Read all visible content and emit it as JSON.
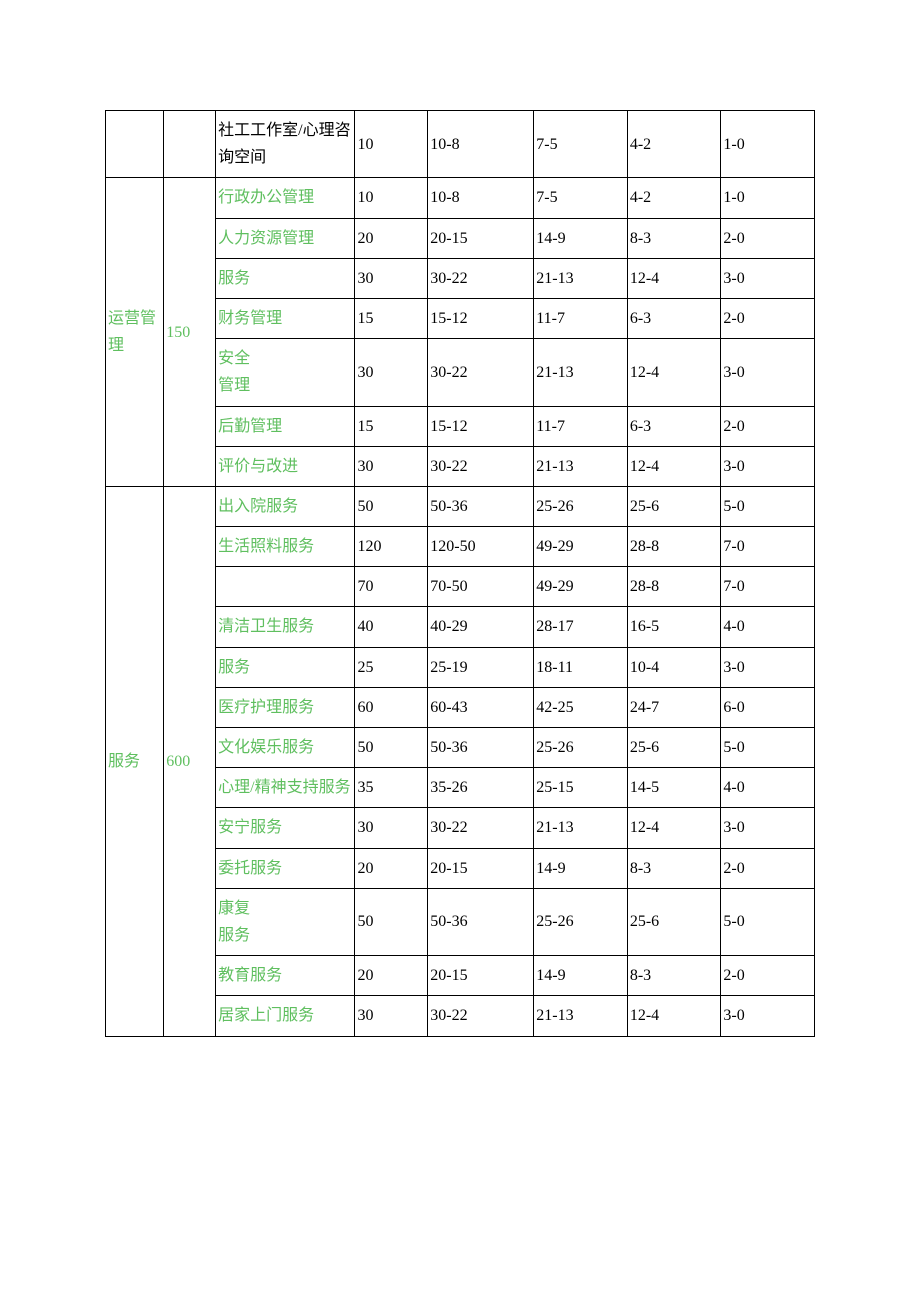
{
  "sections": [
    {
      "cat": "",
      "sub": "",
      "rows": [
        {
          "name": "社工工作室/心理咨询空间",
          "name_green": false,
          "v1": "10",
          "v2": "10-8",
          "v3": "7-5",
          "v4": "4-2",
          "v5": "1-0"
        }
      ]
    },
    {
      "cat": "运营管理",
      "sub": "150",
      "rows": [
        {
          "name": "行政办公管理",
          "name_green": true,
          "v1": "10",
          "v2": "10-8",
          "v3": "7-5",
          "v4": "4-2",
          "v5": "1-0"
        },
        {
          "name": "人力资源管理",
          "name_green": true,
          "v1": "20",
          "v2": "20-15",
          "v3": "14-9",
          "v4": "8-3",
          "v5": "2-0"
        },
        {
          "name": "服务",
          "name_green": true,
          "v1": "30",
          "v2": "30-22",
          "v3": "21-13",
          "v4": "12-4",
          "v5": "3-0"
        },
        {
          "name": "财务管理",
          "name_green": true,
          "v1": "15",
          "v2": "15-12",
          "v3": "11-7",
          "v4": "6-3",
          "v5": "2-0"
        },
        {
          "name": "安全\n管理",
          "name_green": true,
          "v1": "30",
          "v2": "30-22",
          "v3": "21-13",
          "v4": "12-4",
          "v5": "3-0"
        },
        {
          "name": "后勤管理",
          "name_green": true,
          "v1": "15",
          "v2": "15-12",
          "v3": "11-7",
          "v4": "6-3",
          "v5": "2-0"
        },
        {
          "name": "评价与改进",
          "name_green": true,
          "v1": "30",
          "v2": "30-22",
          "v3": "21-13",
          "v4": "12-4",
          "v5": "3-0"
        }
      ]
    },
    {
      "cat": "服务",
      "sub": "600",
      "rows": [
        {
          "name": "出入院服务",
          "name_green": true,
          "v1": "50",
          "v2": "50-36",
          "v3": "25-26",
          "v4": "25-6",
          "v5": "5-0"
        },
        {
          "name": "生活照料服务",
          "name_green": true,
          "v1": "120",
          "v2": "120-50",
          "v3": "49-29",
          "v4": "28-8",
          "v5": "7-0"
        },
        {
          "name": "",
          "name_green": false,
          "v1": "70",
          "v2": "70-50",
          "v3": "49-29",
          "v4": "28-8",
          "v5": "7-0"
        },
        {
          "name": "清洁卫生服务",
          "name_green": true,
          "v1": "40",
          "v2": "40-29",
          "v3": "28-17",
          "v4": "16-5",
          "v5": "4-0"
        },
        {
          "name": "服务",
          "name_green": true,
          "v1": "25",
          "v2": "25-19",
          "v3": "18-11",
          "v4": "10-4",
          "v5": "3-0"
        },
        {
          "name": "医疗护理服务",
          "name_green": true,
          "v1": "60",
          "v2": "60-43",
          "v3": "42-25",
          "v4": "24-7",
          "v5": "6-0"
        },
        {
          "name": "文化娱乐服务",
          "name_green": true,
          "v1": "50",
          "v2": "50-36",
          "v3": "25-26",
          "v4": "25-6",
          "v5": "5-0"
        },
        {
          "name": "心理/精神支持服务",
          "name_green": true,
          "v1": "35",
          "v2": "35-26",
          "v3": "25-15",
          "v4": "14-5",
          "v5": "4-0"
        },
        {
          "name": "安宁服务",
          "name_green": true,
          "v1": "30",
          "v2": "30-22",
          "v3": "21-13",
          "v4": "12-4",
          "v5": "3-0"
        },
        {
          "name": "委托服务",
          "name_green": true,
          "v1": "20",
          "v2": "20-15",
          "v3": "14-9",
          "v4": "8-3",
          "v5": "2-0"
        },
        {
          "name": "康复\n服务",
          "name_green": true,
          "v1": "50",
          "v2": "50-36",
          "v3": "25-26",
          "v4": "25-6",
          "v5": "5-0"
        },
        {
          "name": "教育服务",
          "name_green": true,
          "v1": "20",
          "v2": "20-15",
          "v3": "14-9",
          "v4": "8-3",
          "v5": "2-0"
        },
        {
          "name": "居家上门服务",
          "name_green": true,
          "v1": "30",
          "v2": "30-22",
          "v3": "21-13",
          "v4": "12-4",
          "v5": "3-0"
        }
      ]
    }
  ]
}
